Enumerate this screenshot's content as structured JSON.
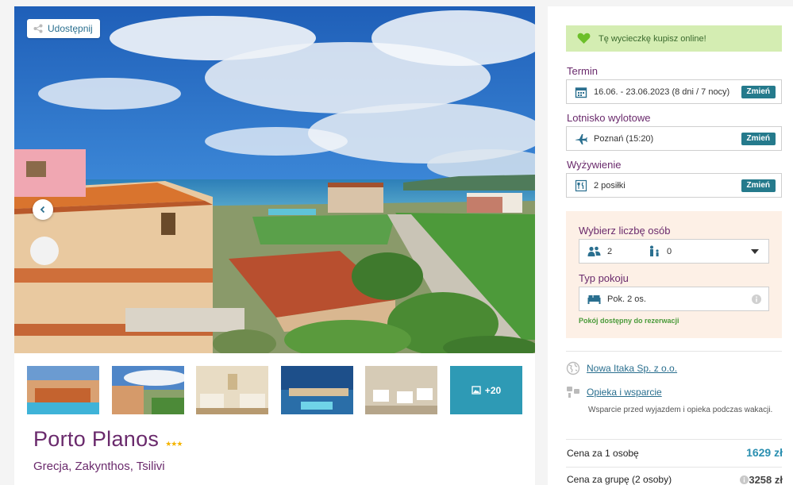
{
  "gallery": {
    "share_label": "Udostępnij",
    "more_label": "+20"
  },
  "hotel": {
    "name": "Porto Planos",
    "stars": "★★★",
    "location": "Grecja, Zakynthos, Tsilivi"
  },
  "booking": {
    "online_text": "Tę wycieczkę kupisz online!",
    "term": {
      "label": "Termin",
      "value": "16.06. - 23.06.2023 (8 dni / 7 nocy)",
      "change": "Zmień"
    },
    "airport": {
      "label": "Lotnisko wylotowe",
      "value": "Poznań (15:20)",
      "change": "Zmień"
    },
    "board": {
      "label": "Wyżywienie",
      "value": "2 posiłki",
      "change": "Zmień"
    },
    "persons": {
      "label": "Wybierz liczbę osób",
      "adults": "2",
      "children": "0"
    },
    "room": {
      "label": "Typ pokoju",
      "value": "Pok. 2 os.",
      "availability": "Pokój dostępny do rezerwacji"
    }
  },
  "organizer": {
    "name": "Nowa Itaka Sp. z o.o.",
    "support_link": "Opieka i wsparcie",
    "support_desc": "Wsparcie przed wyjazdem i opieka podczas wakacji."
  },
  "prices": {
    "per_person_label": "Cena za 1 osobę",
    "per_person_value": "1629 zł",
    "group_label": "Cena za grupę (2 osoby)",
    "group_value": "3258 zł"
  },
  "colors": {
    "brand_purple": "#6a2a6c",
    "accent_teal": "#257a8c",
    "price_blue": "#2a8fb0"
  }
}
